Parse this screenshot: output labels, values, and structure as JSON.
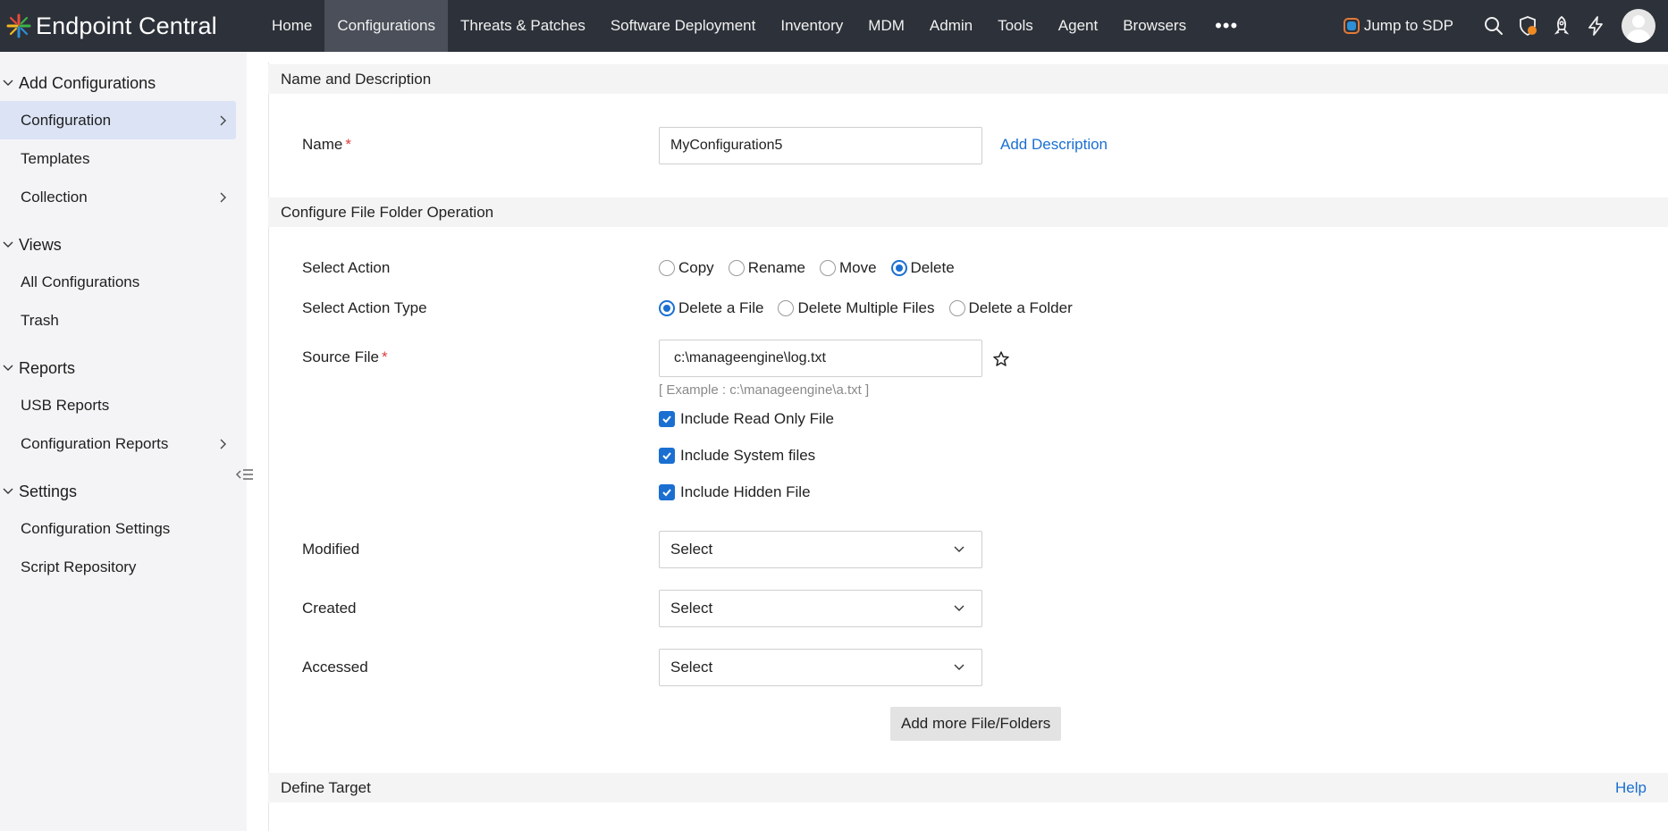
{
  "app": {
    "brand_name": "Endpoint Central"
  },
  "nav": {
    "items": [
      "Home",
      "Configurations",
      "Threats & Patches",
      "Software Deployment",
      "Inventory",
      "MDM",
      "Admin",
      "Tools",
      "Agent",
      "Browsers"
    ],
    "active": "Configurations",
    "more_glyph": "•••"
  },
  "topright": {
    "jump_label": "Jump to SDP",
    "icons": [
      "search-icon",
      "shield-alert-icon",
      "rocket-icon",
      "lightning-icon",
      "avatar"
    ]
  },
  "sidebar": {
    "sections": [
      {
        "title": "Add Configurations",
        "items": [
          {
            "label": "Configuration",
            "has_arrow": true,
            "active": true
          },
          {
            "label": "Templates",
            "has_arrow": false,
            "active": false
          },
          {
            "label": "Collection",
            "has_arrow": true,
            "active": false
          }
        ]
      },
      {
        "title": "Views",
        "items": [
          {
            "label": "All Configurations",
            "has_arrow": false,
            "active": false
          },
          {
            "label": "Trash",
            "has_arrow": false,
            "active": false
          }
        ]
      },
      {
        "title": "Reports",
        "items": [
          {
            "label": "USB Reports",
            "has_arrow": false,
            "active": false
          },
          {
            "label": "Configuration Reports",
            "has_arrow": true,
            "active": false
          }
        ]
      },
      {
        "title": "Settings",
        "items": [
          {
            "label": "Configuration Settings",
            "has_arrow": false,
            "active": false
          },
          {
            "label": "Script Repository",
            "has_arrow": false,
            "active": false
          }
        ]
      }
    ]
  },
  "form": {
    "name_section_title": "Name and Description",
    "name_label": "Name",
    "required_mark": "*",
    "name_value": "MyConfiguration5",
    "add_description": "Add Description",
    "config_section_title": "Configure File Folder Operation",
    "select_action_label": "Select Action",
    "actions": [
      {
        "label": "Copy",
        "selected": false
      },
      {
        "label": "Rename",
        "selected": false
      },
      {
        "label": "Move",
        "selected": false
      },
      {
        "label": "Delete",
        "selected": true
      }
    ],
    "select_action_type_label": "Select Action Type",
    "action_types": [
      {
        "label": "Delete a File",
        "selected": true
      },
      {
        "label": "Delete Multiple Files",
        "selected": false
      },
      {
        "label": "Delete a Folder",
        "selected": false
      }
    ],
    "source_file_label": "Source File",
    "source_file_value": "c:\\manageengine\\log.txt",
    "source_file_example": "[ Example : c:\\manageengine\\a.txt ]",
    "checkboxes": [
      {
        "label": "Include Read Only File",
        "checked": true
      },
      {
        "label": "Include System files",
        "checked": true
      },
      {
        "label": "Include Hidden File",
        "checked": true
      }
    ],
    "modified_label": "Modified",
    "modified_value": "Select",
    "created_label": "Created",
    "created_value": "Select",
    "accessed_label": "Accessed",
    "accessed_value": "Select",
    "add_more_button": "Add more File/Folders",
    "target_section_title": "Define Target",
    "help_link": "Help"
  },
  "colors": {
    "topbar_bg": "#2d3139",
    "nav_active_bg": "#4a4f59",
    "sidebar_bg": "#f4f4f6",
    "sidebar_active_bg": "#dbe3f5",
    "accent_blue": "#1a6fd1",
    "required_red": "#e03b3b",
    "section_bg": "#f4f4f4"
  }
}
